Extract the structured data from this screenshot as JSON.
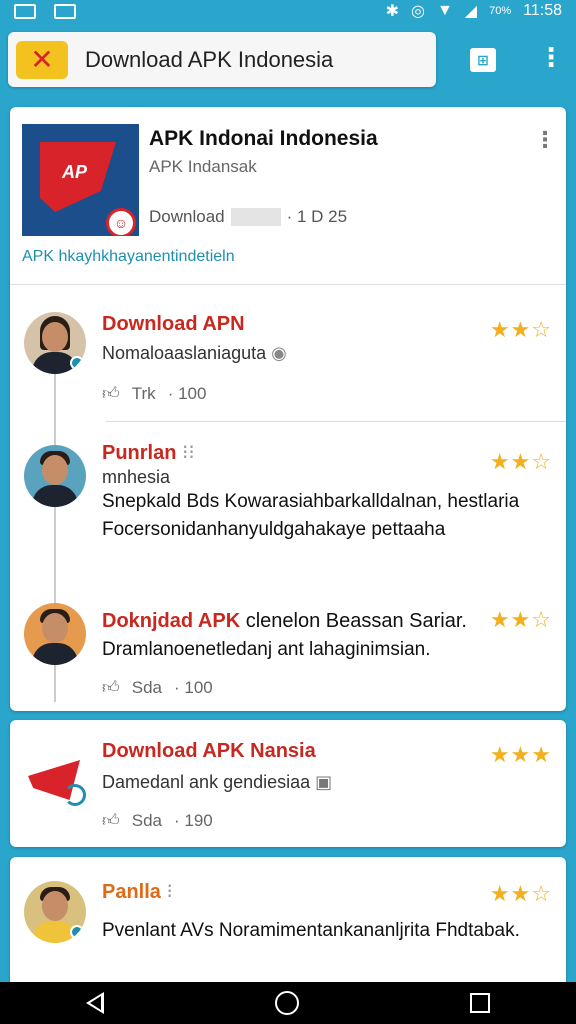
{
  "status_bar": {
    "percent": "70%",
    "time": "11:58"
  },
  "toolbar": {
    "search_text": "Download APK Indonesia"
  },
  "app_header": {
    "title": "APK Indonai Indonesia",
    "developer": "APK Indansak",
    "download_label": "Download",
    "download_count": "· 1 D 25",
    "banner_text": "AP",
    "link_text": "APK hkayhkhayanentindetieln"
  },
  "reviews": [
    {
      "title": "Download APN",
      "subtitle": "Nomaloaaslaniaguta",
      "stars": "★★☆",
      "meta_label": "Trk",
      "meta_count": "· 100"
    },
    {
      "title": "Punrlan",
      "subtitle": "mnhesia",
      "body": "Snepkald Bds Kowarasiahbarkalldalnan, hestlaria Focersonidanhanyuldgahakaye pettaaha",
      "stars": "★★☆"
    },
    {
      "title": "Doknjdad APK",
      "title_rest": "clenelon Beassan Sariar.",
      "subtitle": "Dramlanoenetledanj ant lahaginimsian.",
      "stars": "★★☆",
      "meta_label": "Sda",
      "meta_count": "· 100"
    }
  ],
  "card2": {
    "title": "Download APK Nansia",
    "subtitle": "Damedanl ank gendiesiaa",
    "stars": "★★★",
    "meta_label": "Sda",
    "meta_count": "· 190"
  },
  "card3": {
    "title": "Panlla",
    "body": "Pvenlant AVs Noramimentankananljrita Fhdtabak.",
    "stars": "★★☆"
  }
}
